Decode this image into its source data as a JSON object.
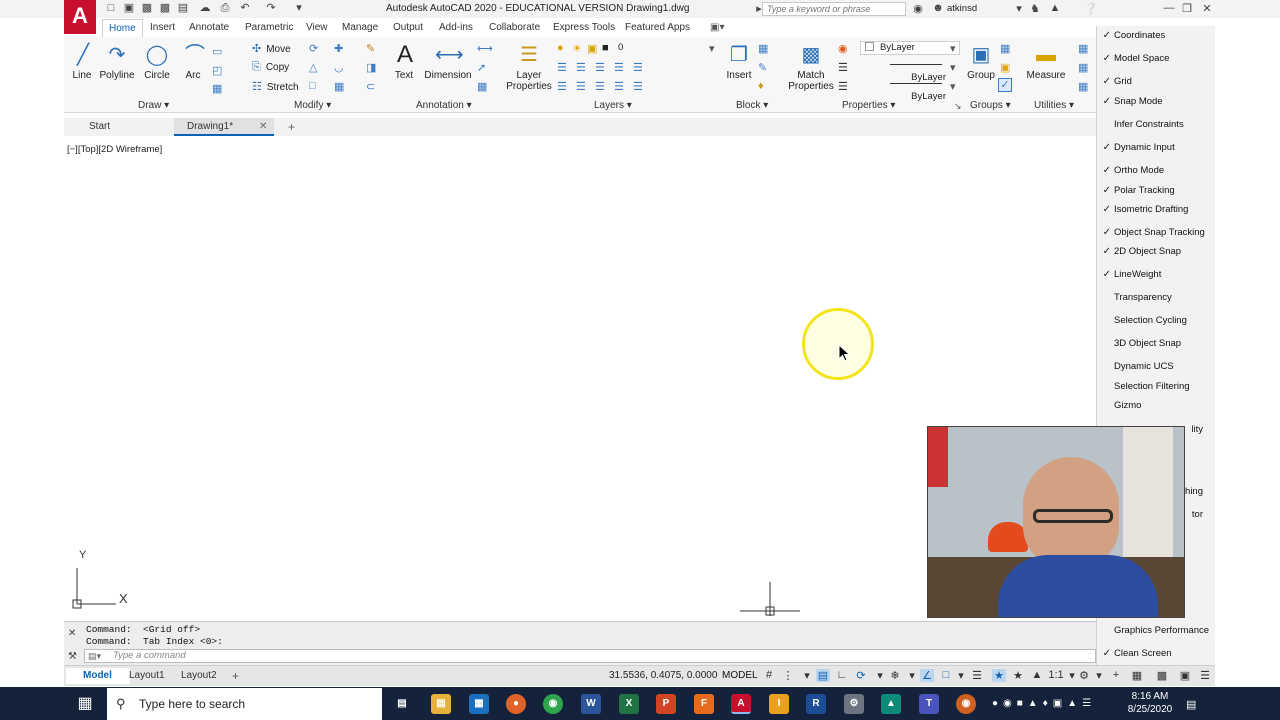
{
  "window": {
    "title": "Autodesk AutoCAD 2020 - EDUCATIONAL VERSION    Drawing1.dwg",
    "logo_letter": "A",
    "search_placeholder": "Type a keyword or phrase",
    "username": "atkinsd"
  },
  "ribbon_tabs": [
    "Home",
    "Insert",
    "Annotate",
    "Parametric",
    "View",
    "Manage",
    "Output",
    "Add-ins",
    "Collaborate",
    "Express Tools",
    "Featured Apps"
  ],
  "active_tab": "Home",
  "ribbon": {
    "draw": {
      "title": "Draw",
      "tools": [
        "Line",
        "Polyline",
        "Circle",
        "Arc"
      ]
    },
    "modify": {
      "title": "Modify",
      "tools": [
        "Move",
        "Copy",
        "Stretch"
      ]
    },
    "annotation": {
      "title": "Annotation",
      "tools": [
        "Text",
        "Dimension"
      ]
    },
    "layers": {
      "title": "Layers",
      "tool_line1": "Layer",
      "tool_line2": "Properties",
      "current_layer": "0"
    },
    "block": {
      "title": "Block",
      "tool": "Insert"
    },
    "properties": {
      "title": "Properties",
      "tool_line1": "Match",
      "tool_line2": "Properties",
      "color": "ByLayer",
      "linetype": "ByLayer",
      "lineweight": "ByLayer"
    },
    "groups": {
      "title": "Groups",
      "tool": "Group"
    },
    "utilities": {
      "title": "Utilities",
      "tool": "Measure"
    }
  },
  "doc_tabs": {
    "start": "Start",
    "drawing": "Drawing1*"
  },
  "viewport_label": "[−][Top][2D Wireframe]",
  "ucs": {
    "x": "X",
    "y": "Y"
  },
  "status_menu": {
    "items": [
      {
        "label": "Coordinates",
        "checked": true
      },
      {
        "label": "Model Space",
        "checked": true
      },
      {
        "label": "Grid",
        "checked": true
      },
      {
        "label": "Snap Mode",
        "checked": true
      },
      {
        "label": "Infer Constraints",
        "checked": false
      },
      {
        "label": "Dynamic Input",
        "checked": true
      },
      {
        "label": "Ortho Mode",
        "checked": true
      },
      {
        "label": "Polar Tracking",
        "checked": true
      },
      {
        "label": "Isometric Drafting",
        "checked": true
      },
      {
        "label": "Object Snap Tracking",
        "checked": true
      },
      {
        "label": "2D Object Snap",
        "checked": true
      },
      {
        "label": "LineWeight",
        "checked": true
      },
      {
        "label": "Transparency",
        "checked": false
      },
      {
        "label": "Selection Cycling",
        "checked": false
      },
      {
        "label": "3D Object Snap",
        "checked": false
      },
      {
        "label": "Dynamic UCS",
        "checked": false
      },
      {
        "label": "Selection Filtering",
        "checked": false
      },
      {
        "label": "Gizmo",
        "checked": false
      }
    ],
    "partial": [
      "lity",
      "hing",
      "tor"
    ],
    "bottom": [
      {
        "label": "Graphics Performance",
        "checked": false
      },
      {
        "label": "Clean Screen",
        "checked": true
      }
    ]
  },
  "command": {
    "history": [
      "Command:  <Grid off>",
      "Command:  Tab Index <0>:"
    ],
    "placeholder": "Type a command"
  },
  "layouts": [
    "Model",
    "Layout1",
    "Layout2"
  ],
  "status": {
    "coordinates": "31.5536, 0.4075, 0.0000",
    "mode": "MODEL",
    "scale": "1:1"
  },
  "taskbar": {
    "search_placeholder": "Type here to search",
    "time": "8:16 AM",
    "date": "8/25/2020"
  },
  "colors": {
    "accent": "#0a63b5",
    "autocad_red": "#c8102e",
    "taskbar": "#14233b",
    "cursor_halo": "#f2e51c"
  }
}
